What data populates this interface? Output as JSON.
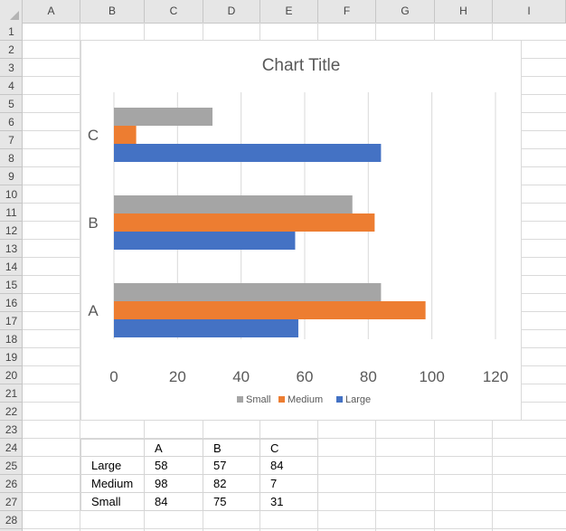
{
  "sheet": {
    "columns": [
      "A",
      "B",
      "C",
      "D",
      "E",
      "F",
      "G",
      "H",
      "I"
    ],
    "rows": [
      "1",
      "2",
      "3",
      "4",
      "5",
      "6",
      "7",
      "8",
      "9",
      "10",
      "11",
      "12",
      "13",
      "14",
      "15",
      "16",
      "17",
      "18",
      "19",
      "20",
      "21",
      "22",
      "23",
      "24",
      "25",
      "26",
      "27",
      "28"
    ]
  },
  "table": {
    "header": [
      "",
      "A",
      "B",
      "C"
    ],
    "rows": [
      [
        "Large",
        "58",
        "57",
        "84"
      ],
      [
        "Medium",
        "98",
        "82",
        "7"
      ],
      [
        "Small",
        "84",
        "75",
        "31"
      ]
    ]
  },
  "chart_data": {
    "type": "bar",
    "orientation": "horizontal",
    "title": "Chart Title",
    "categories": [
      "A",
      "B",
      "C"
    ],
    "series": [
      {
        "name": "Small",
        "values": [
          84,
          75,
          31
        ],
        "color": "#a5a5a5"
      },
      {
        "name": "Medium",
        "values": [
          98,
          82,
          7
        ],
        "color": "#ed7d31"
      },
      {
        "name": "Large",
        "values": [
          58,
          57,
          84
        ],
        "color": "#4472c4"
      }
    ],
    "xlim": [
      0,
      120
    ],
    "xticks": [
      "0",
      "20",
      "40",
      "60",
      "80",
      "100",
      "120"
    ],
    "grid": true,
    "legend_position": "bottom"
  }
}
